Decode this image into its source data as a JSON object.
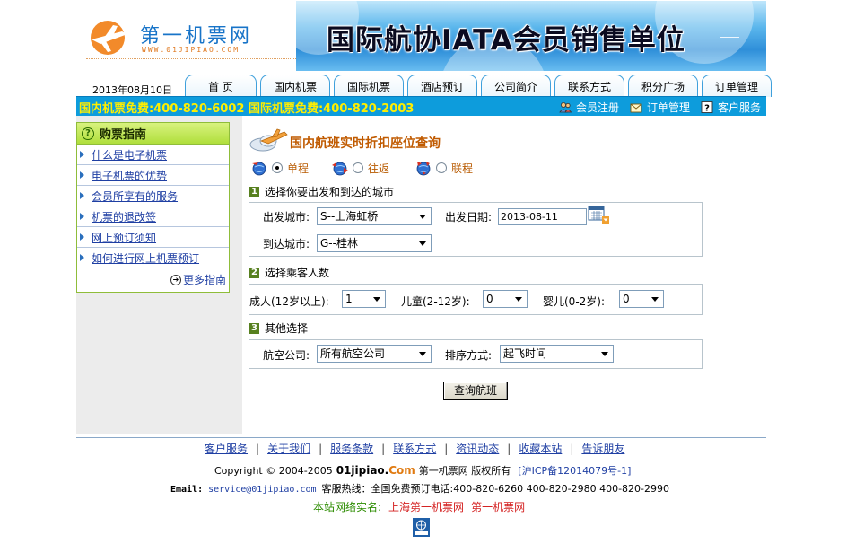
{
  "header": {
    "logo_name": "第一机票网",
    "logo_url": "WWW.01JIPIAO.COM",
    "banner_text": "国际航协IATA会员销售单位"
  },
  "nav": {
    "date": "2013年08月10日",
    "tabs": [
      "首 页",
      "国内机票",
      "国际机票",
      "酒店预订",
      "公司简介",
      "联系方式",
      "积分广场",
      "订单管理"
    ]
  },
  "bar": {
    "hotline": "国内机票免费:400-820-6002 国际机票免费:400-820-2003",
    "links": {
      "register": "会员注册",
      "orders": "订单管理",
      "service": "客户服务"
    }
  },
  "sidebar": {
    "title": "购票指南",
    "items": [
      "什么是电子机票",
      "电子机票的优势",
      "会员所享有的服务",
      "机票的退改签",
      "网上预订须知",
      "如何进行网上机票预订"
    ],
    "more": "更多指南"
  },
  "main": {
    "title": "国内航班实时折扣座位查询",
    "trip_types": [
      "单程",
      "往返",
      "联程"
    ],
    "selected_trip": "单程",
    "step1": {
      "num": "1",
      "label": "选择你要出发和到达的城市",
      "depart_label": "出发城市:",
      "depart_value": "S--上海虹桥",
      "date_label": "出发日期:",
      "date_value": "2013-08-11",
      "arrive_label": "到达城市:",
      "arrive_value": "G--桂林"
    },
    "step2": {
      "num": "2",
      "label": "选择乘客人数",
      "adult_label": "成人(12岁以上):",
      "adult_value": "1",
      "child_label": "儿童(2-12岁):",
      "child_value": "0",
      "infant_label": "婴儿(0-2岁):",
      "infant_value": "0"
    },
    "step3": {
      "num": "3",
      "label": "其他选择",
      "airline_label": "航空公司:",
      "airline_value": "所有航空公司",
      "sort_label": "排序方式:",
      "sort_value": "起飞时间"
    },
    "search_button": "查询航班"
  },
  "footer": {
    "links": [
      "客户服务",
      "关于我们",
      "服务条款",
      "联系方式",
      "资讯动态",
      "收藏本站",
      "告诉朋友"
    ],
    "copyright_prefix": "Copyright © 2004-2005",
    "site_domain": "01jipiao.",
    "site_tld": "Com",
    "site_suffix": "第一机票网  版权所有",
    "icp": "[沪ICP备12014079号-1]",
    "email_label": "Email:",
    "email": "service@01jipiao.com",
    "hotline_text": "客服热线：全国免费预订电话:400-820-6260  400-820-2980  400-820-2990",
    "realname_label": "本站网络实名:",
    "realname_1": "上海第一机票网",
    "realname_2": "第一机票网"
  }
}
